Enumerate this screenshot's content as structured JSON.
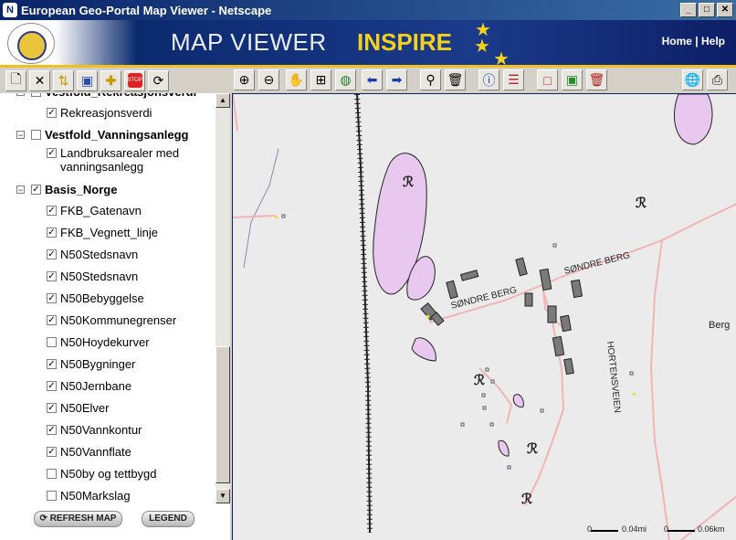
{
  "window": {
    "title": "European Geo-Portal Map Viewer - Netscape",
    "min": "_",
    "max": "□",
    "close": "✕"
  },
  "banner": {
    "app_name": "MAP VIEWER",
    "brand": "INSPIRE",
    "home": "Home",
    "sep": " | ",
    "help": "Help"
  },
  "left_toolbar": {
    "icons": [
      "new-layer-icon",
      "delete-layer-icon",
      "layer-order-icon",
      "layer-properties-icon",
      "add-layer-icon",
      "stop-icon",
      "refresh-icon"
    ],
    "stop_label": "STOP"
  },
  "layers": [
    {
      "label": "Vestfold_Rekreasjonsverdi",
      "level": 0,
      "checked": true,
      "partial": true
    },
    {
      "label": "Rekreasjonsverdi",
      "level": 1,
      "checked": true
    },
    {
      "label": "Vestfold_Vanningsanlegg",
      "level": 0,
      "checked": false
    },
    {
      "label": "Landbruksarealer med vanningsanlegg",
      "level": 1,
      "checked": true
    },
    {
      "label": "Basis_Norge",
      "level": 0,
      "checked": true
    },
    {
      "label": "FKB_Gatenavn",
      "level": 1,
      "checked": true
    },
    {
      "label": "FKB_Vegnett_linje",
      "level": 1,
      "checked": true
    },
    {
      "label": "N50Stedsnavn",
      "level": 1,
      "checked": true
    },
    {
      "label": "N50Stedsnavn",
      "level": 1,
      "checked": true
    },
    {
      "label": "N50Bebyggelse",
      "level": 1,
      "checked": true
    },
    {
      "label": "N50Kommunegrenser",
      "level": 1,
      "checked": true
    },
    {
      "label": "N50Hoydekurver",
      "level": 1,
      "checked": false
    },
    {
      "label": "N50Bygninger",
      "level": 1,
      "checked": true
    },
    {
      "label": "N50Jernbane",
      "level": 1,
      "checked": true
    },
    {
      "label": "N50Elver",
      "level": 1,
      "checked": true
    },
    {
      "label": "N50Vannkontur",
      "level": 1,
      "checked": true
    },
    {
      "label": "N50Vannflate",
      "level": 1,
      "checked": true
    },
    {
      "label": "N50by og tettbygd",
      "level": 1,
      "checked": false
    },
    {
      "label": "N50Markslag",
      "level": 1,
      "checked": false
    }
  ],
  "buttons": {
    "refresh": "REFRESH MAP",
    "legend": "LEGEND"
  },
  "map_toolbar": {
    "icons": [
      "zoom-in-icon",
      "zoom-out-icon",
      "pan-icon",
      "zoom-box-icon",
      "full-extent-icon",
      "back-icon",
      "forward-icon",
      "find-icon",
      "clear-icon",
      "info-icon",
      "legend-list-icon",
      "select-rect-icon",
      "select-point-icon",
      "clear-selection-icon",
      "globe-icon",
      "print-icon"
    ]
  },
  "map": {
    "labels": {
      "road1": "SØNDRE BERG",
      "road2": "SØNDRE BERG",
      "road3": "HORTENSVEIEN",
      "place": "Berg"
    },
    "scale": {
      "zero1": "0",
      "val1": "0.04mi",
      "zero2": "0",
      "val2": "0.06km"
    },
    "colors": {
      "water": "#e8c8ee",
      "road": "#f2b4b4",
      "building": "#7a7a7a",
      "rail": "#222222"
    }
  }
}
